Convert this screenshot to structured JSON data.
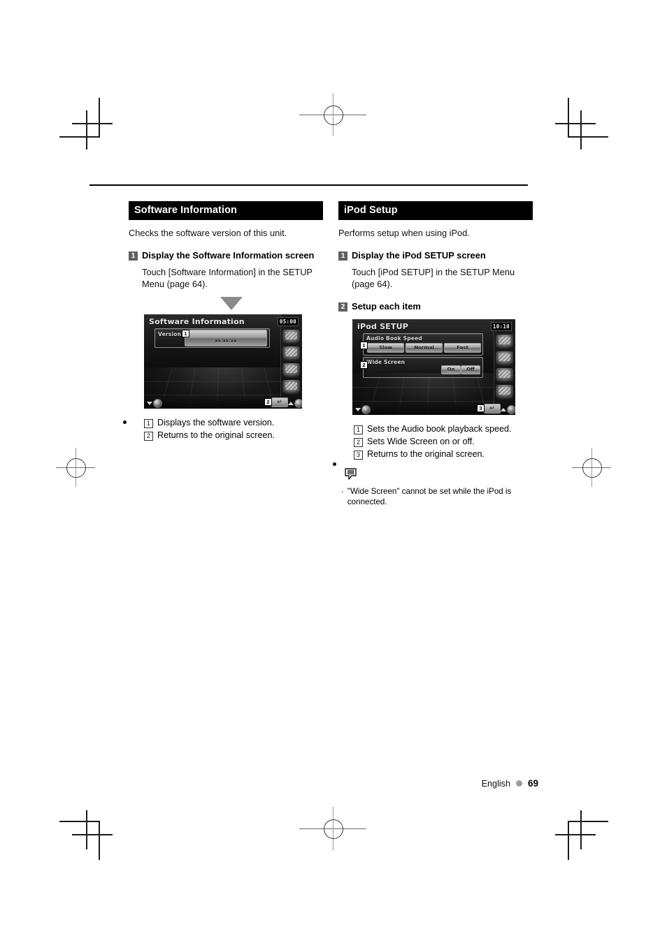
{
  "page": {
    "footer_language": "English",
    "footer_page_number": "69"
  },
  "left_column": {
    "heading": "Software Information",
    "lead": "Checks the software version of this unit.",
    "step": {
      "number": "1",
      "title": "Display the Software Information screen",
      "body": "Touch [Software Information] in the SETUP Menu (page 64)."
    },
    "device_screen": {
      "title": "Software Information",
      "clock": "05:00",
      "field_label": "Version",
      "field_value": "xx.xx.xx",
      "callouts": {
        "version": "1",
        "return": "2"
      }
    },
    "results": [
      {
        "num": "1",
        "text": "Displays the software version."
      },
      {
        "num": "2",
        "text": "Returns to the original screen."
      }
    ]
  },
  "right_column": {
    "heading": "iPod Setup",
    "lead": "Performs setup when using iPod.",
    "step1": {
      "number": "1",
      "title": "Display the iPod SETUP screen",
      "body": "Touch [iPod SETUP] in the SETUP Menu (page 64)."
    },
    "step2": {
      "number": "2",
      "title": "Setup each item"
    },
    "device_screen": {
      "title": "iPod SETUP",
      "clock": "10:10",
      "audio_book_speed_label": "Audio Book Speed",
      "speed_options": [
        "Slow",
        "Normal",
        "Fast"
      ],
      "wide_screen_label": "Wide Screen",
      "wide_screen_options": [
        "On",
        "Off"
      ],
      "callouts": {
        "audio_book": "1",
        "wide_screen": "2",
        "return": "3"
      }
    },
    "results": [
      {
        "num": "1",
        "text": "Sets the Audio book playback speed."
      },
      {
        "num": "2",
        "text": "Sets Wide Screen on or off."
      },
      {
        "num": "3",
        "text": "Returns to the original screen."
      }
    ],
    "note": {
      "bullet": "·",
      "text": "\"Wide Screen\" cannot be set while the iPod is connected."
    }
  }
}
